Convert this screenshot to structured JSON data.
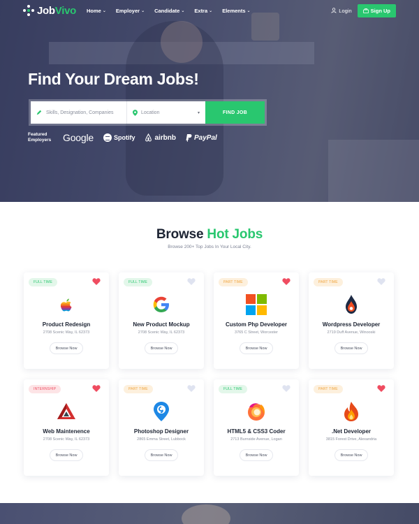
{
  "header": {
    "logo_part1": "Job",
    "logo_part2": "Vivo",
    "nav": [
      {
        "label": "Home"
      },
      {
        "label": "Employer"
      },
      {
        "label": "Candidate"
      },
      {
        "label": "Extra"
      },
      {
        "label": "Elements"
      }
    ],
    "login": "Login",
    "signup": "Sign Up"
  },
  "hero": {
    "title": "Find Your Dream Jobs!",
    "search": {
      "keyword_placeholder": "Skills, Designation, Companies",
      "location_placeholder": "Location",
      "button": "FIND JOB"
    },
    "featured_label_line1": "Featured",
    "featured_label_line2": "Employers",
    "brands": [
      "Google",
      "Spotify",
      "airbnb",
      "PayPal"
    ]
  },
  "hot_jobs": {
    "title_part1": "Browse",
    "title_part2": "Hot Jobs",
    "subtitle": "Browse 200+ Top Jobs In Your Local City.",
    "browse_label": "Browse Now",
    "jobs": [
      {
        "badge": "FULL TIME",
        "title": "Product Redesign",
        "address": "2708 Scenic Way, IL 62373",
        "liked": true
      },
      {
        "badge": "FULL TIME",
        "title": "New Product Mockup",
        "address": "2708 Scenic Way, IL 62373",
        "liked": false
      },
      {
        "badge": "PART TIME",
        "title": "Custom Php Developer",
        "address": "3765 C Street, Worcester",
        "liked": true
      },
      {
        "badge": "PART TIME",
        "title": "Wordpress Developer",
        "address": "2719 Duff Avenue, Winooski",
        "liked": false
      },
      {
        "badge": "INTERNSHIP",
        "title": "Web Maintenence",
        "address": "2708 Scenic Way, IL 62373",
        "liked": true
      },
      {
        "badge": "PART TIME",
        "title": "Photoshop Designer",
        "address": "2865 Emma Street, Lubbock",
        "liked": false
      },
      {
        "badge": "FULL TIME",
        "title": "HTML5 & CSS3 Coder",
        "address": "2713 Burnside Avenue, Logan",
        "liked": false
      },
      {
        "badge": "PART TIME",
        "title": ".Net Developer",
        "address": "3815 Forest Drive, Alexandria",
        "liked": true
      }
    ]
  },
  "colors": {
    "accent": "#29c76f",
    "heart_liked": "#ef4c60",
    "heart_unliked": "#dfe3f0"
  }
}
